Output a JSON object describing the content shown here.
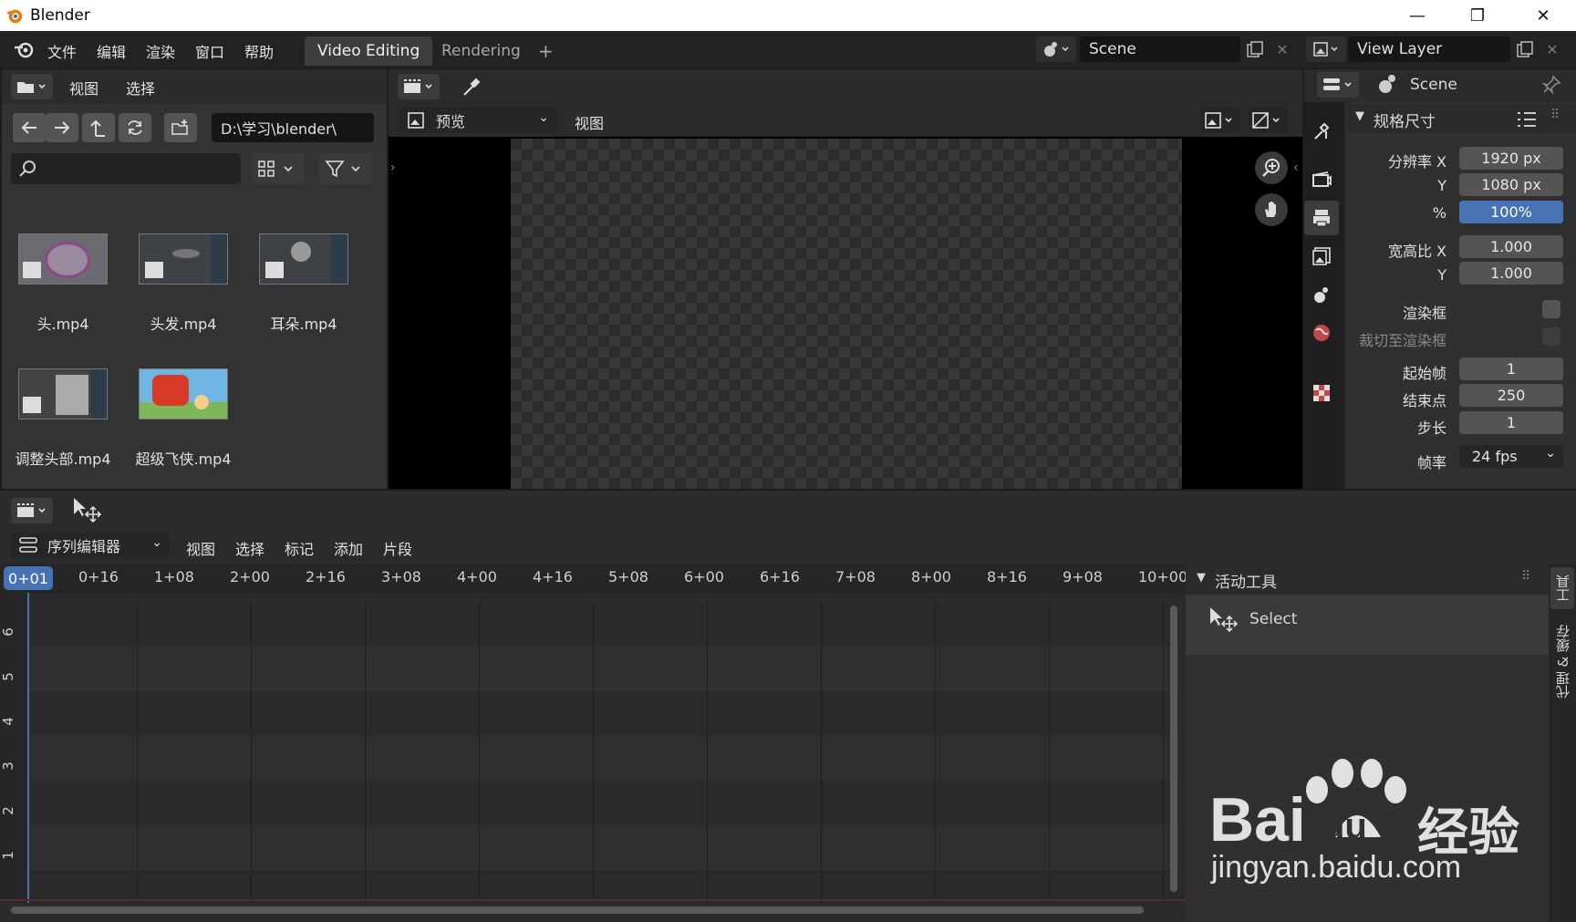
{
  "window": {
    "title": "Blender",
    "minimize": "—",
    "restore": "❐",
    "close": "✕"
  },
  "menubar": {
    "items": [
      "文件",
      "编辑",
      "渲染",
      "窗口",
      "帮助"
    ]
  },
  "workspaces": {
    "tabs": [
      "Video Editing",
      "Rendering"
    ],
    "add": "+"
  },
  "scene": {
    "name": "Scene"
  },
  "view_layer": {
    "name": "View Layer"
  },
  "file_browser": {
    "menu": [
      "视图",
      "选择"
    ],
    "path": "D:\\学习\\blender\\",
    "files": [
      {
        "name": "头.mp4"
      },
      {
        "name": "头发.mp4"
      },
      {
        "name": "耳朵.mp4"
      },
      {
        "name": "调整头部.mp4"
      },
      {
        "name": "超级飞侠.mp4"
      }
    ]
  },
  "preview": {
    "mode": "预览",
    "menu": "视图"
  },
  "properties": {
    "scene_label": "Scene",
    "section_title": "规格尺寸",
    "resolution_x_label": "分辨率 X",
    "resolution_x": "1920 px",
    "resolution_y_label": "Y",
    "resolution_y": "1080 px",
    "percent_label": "%",
    "percent": "100%",
    "aspect_x_label": "宽高比 X",
    "aspect_x": "1.000",
    "aspect_y_label": "Y",
    "aspect_y": "1.000",
    "render_region_label": "渲染框",
    "crop_label": "裁切至渲染框",
    "frame_start_label": "起始帧",
    "frame_start": "1",
    "frame_end_label": "结束点",
    "frame_end": "250",
    "frame_step_label": "步长",
    "frame_step": "1",
    "fps_label": "帧率",
    "fps": "24 fps"
  },
  "sequencer": {
    "editor_type": "序列编辑器",
    "menu": [
      "视图",
      "选择",
      "标记",
      "添加",
      "片段"
    ],
    "current_frame": "0+01",
    "ruler": [
      "0+16",
      "1+08",
      "2+00",
      "2+16",
      "3+08",
      "4+00",
      "4+16",
      "5+08",
      "6+00",
      "6+16",
      "7+08",
      "8+00",
      "8+16",
      "9+08",
      "10+00"
    ],
    "channels": [
      "6",
      "5",
      "4",
      "3",
      "2",
      "1"
    ]
  },
  "sidebar": {
    "active_tool_title": "活动工具",
    "tool_name": "Select",
    "tabs": [
      "工具",
      "代理 & 缓存"
    ]
  },
  "watermark": {
    "brand": "Bai",
    "brand2": "du",
    "cn": "经验",
    "url": "jingyan.baidu.com"
  },
  "colors": {
    "accent_blue": "#4772b3",
    "bg_dark": "#1d1d1d",
    "panel": "#303030"
  }
}
